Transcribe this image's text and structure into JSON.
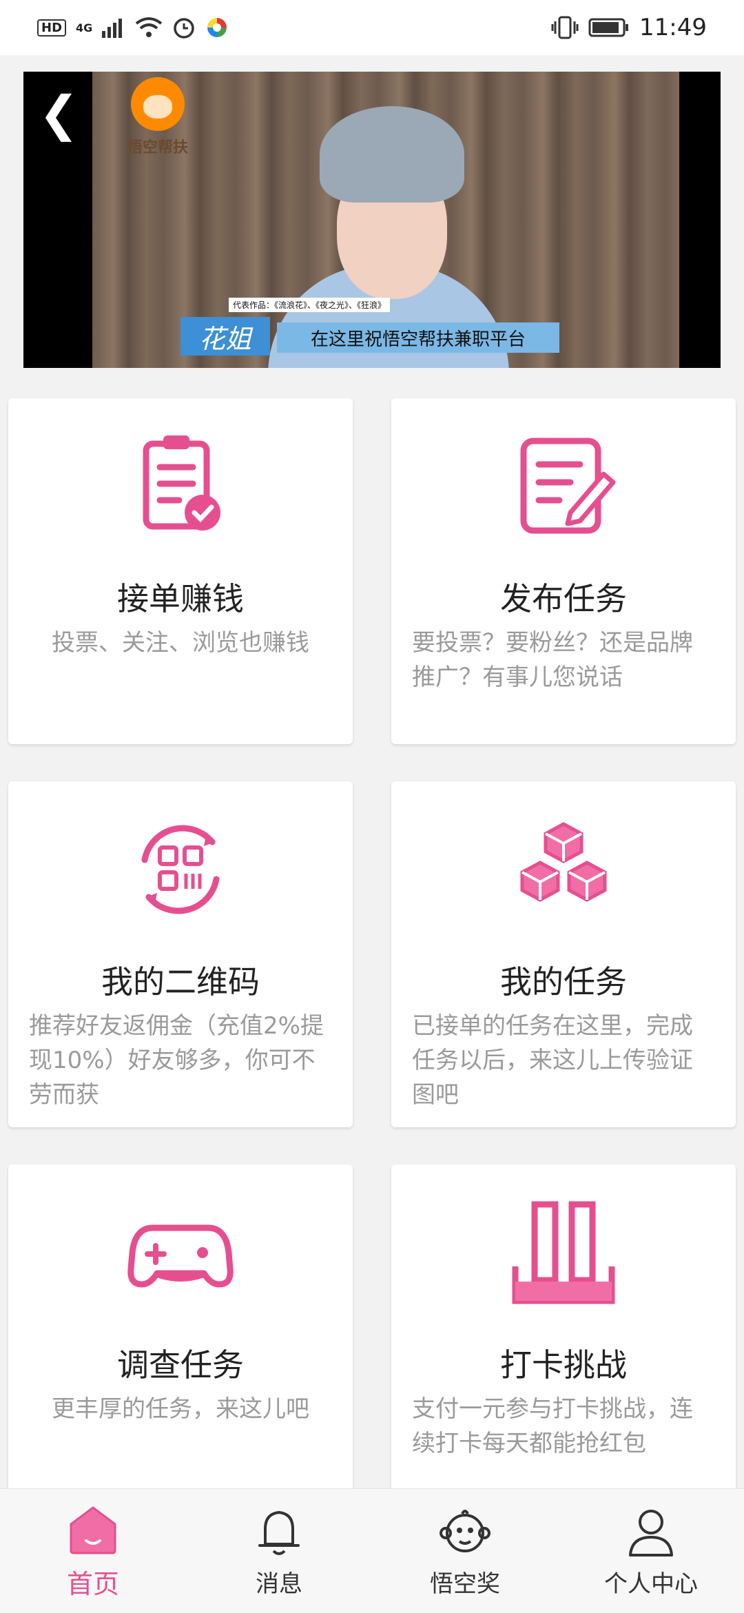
{
  "status_bar": {
    "hd_badge": "HD",
    "network": "4G",
    "time": "11:49"
  },
  "video": {
    "logo_text": "悟空帮扶",
    "subtitle_name": "花姐",
    "subtitle_credit": "代表作品：《流浪花》、《夜之光》、《狂浪》",
    "subtitle_line": "在这里祝悟空帮扶兼职平台"
  },
  "cards": [
    {
      "title": "接单赚钱",
      "desc": "投票、关注、浏览也赚钱",
      "icon": "clipboard-check-icon"
    },
    {
      "title": "发布任务",
      "desc": "要投票？要粉丝？还是品牌推广？有事儿您说话",
      "icon": "edit-document-icon"
    },
    {
      "title": "我的二维码",
      "desc": "推荐好友返佣金（充值2%提现10%）好友够多，你可不劳而获",
      "icon": "qr-code-icon"
    },
    {
      "title": "我的任务",
      "desc": "已接单的任务在这里，完成任务以后，来这儿上传验证图吧",
      "icon": "cubes-icon"
    },
    {
      "title": "调查任务",
      "desc": "更丰厚的任务，来这儿吧",
      "icon": "gamepad-icon"
    },
    {
      "title": "打卡挑战",
      "desc": "支付一元参与打卡挑战，连续打卡每天都能抢红包",
      "icon": "checkin-bars-icon"
    }
  ],
  "tabbar": [
    {
      "label": "首页",
      "icon": "home-icon",
      "active": true
    },
    {
      "label": "消息",
      "icon": "bell-icon",
      "active": false
    },
    {
      "label": "悟空奖",
      "icon": "monkey-icon",
      "active": false
    },
    {
      "label": "个人中心",
      "icon": "person-icon",
      "active": false
    }
  ],
  "colors": {
    "accent": "#e64f8f",
    "background": "#f2f2f2"
  }
}
